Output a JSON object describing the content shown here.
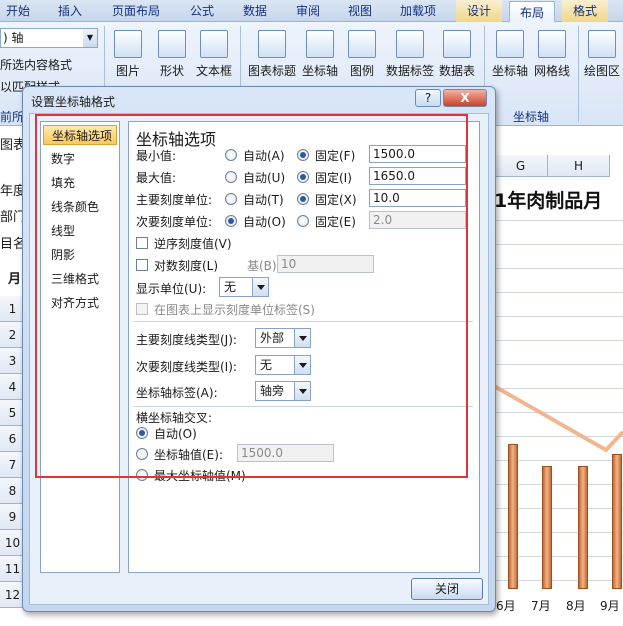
{
  "ribbon": {
    "tabs": [
      "开始",
      "插入",
      "页面布局",
      "公式",
      "数据",
      "审阅",
      "视图",
      "加载项",
      "设计",
      "布局",
      "格式"
    ],
    "axis_dropdown": ") 轴",
    "left_items": [
      "所选内容格式",
      "以匹配样式",
      "前所"
    ],
    "buttons": [
      "图片",
      "形状",
      "文本框",
      "图表标题",
      "坐标轴",
      "图例",
      "数据标签",
      "数据表",
      "坐标轴",
      "网格线",
      "绘图区"
    ],
    "group_axis_label": "坐标轴"
  },
  "sheet": {
    "left_text": [
      "图表",
      "年度",
      "部门",
      "目名",
      "月"
    ],
    "row_numbers": [
      "1",
      "2",
      "3",
      "4",
      "5",
      "6",
      "7",
      "8",
      "9",
      "10",
      "11",
      "12"
    ],
    "columns": [
      "G",
      "H"
    ],
    "chart_title": "1年肉制品月",
    "months": [
      "6月",
      "7月",
      "8月",
      "9月"
    ]
  },
  "dialog": {
    "title": "设置坐标轴格式",
    "help": "?",
    "close_x": "X",
    "nav": [
      "坐标轴选项",
      "数字",
      "填充",
      "线条颜色",
      "线型",
      "阴影",
      "三维格式",
      "对齐方式"
    ],
    "panel": {
      "heading": "坐标轴选项",
      "min_label": "最小值:",
      "min_auto": "自动(A)",
      "min_fixed": "固定(F)",
      "min_value": "1500.0",
      "max_label": "最大值:",
      "max_auto": "自动(U)",
      "max_fixed": "固定(I)",
      "max_value": "1650.0",
      "major_label": "主要刻度单位:",
      "major_auto": "自动(T)",
      "major_fixed": "固定(X)",
      "major_value": "10.0",
      "minor_label": "次要刻度单位:",
      "minor_auto": "自动(O)",
      "minor_fixed": "固定(E)",
      "minor_value": "2.0",
      "reverse_label": "逆序刻度值(V)",
      "log_label": "对数刻度(L)",
      "base_label": "基(B):",
      "base_value": "10",
      "display_unit_label": "显示单位(U):",
      "display_unit_value": "无",
      "show_unit_label": "在图表上显示刻度单位标签(S)",
      "major_tick_label": "主要刻度线类型(J):",
      "major_tick_value": "外部",
      "minor_tick_label": "次要刻度线类型(I):",
      "minor_tick_value": "无",
      "axis_labels_label": "坐标轴标签(A):",
      "axis_labels_value": "轴旁",
      "cross_label": "横坐标轴交叉:",
      "cross_auto": "自动(O)",
      "cross_value_label": "坐标轴值(E):",
      "cross_value": "1500.0",
      "cross_max": "最大坐标轴值(M)"
    },
    "close_button": "关闭"
  }
}
